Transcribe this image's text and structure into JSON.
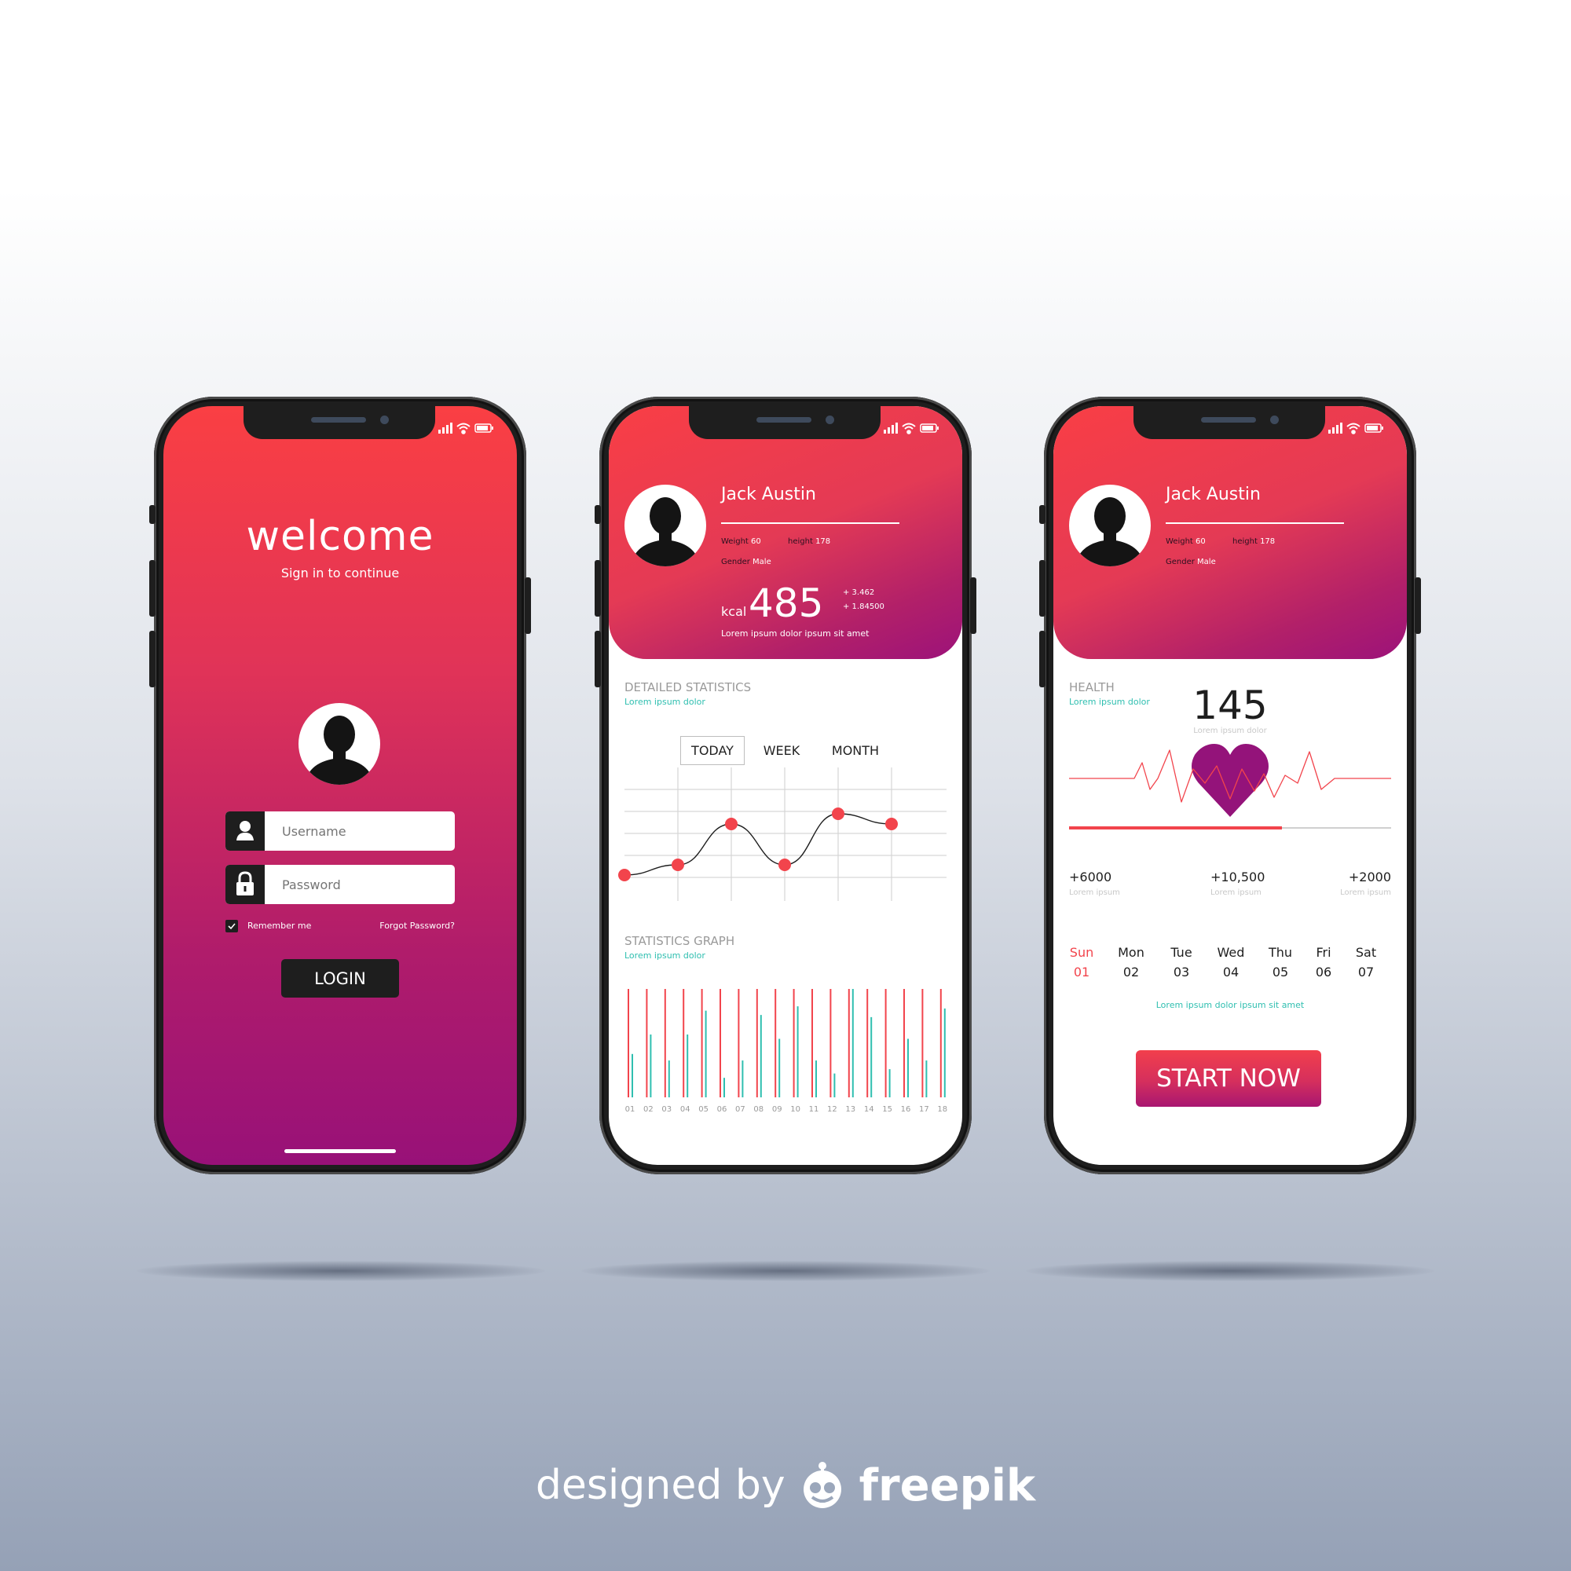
{
  "login_screen": {
    "title": "welcome",
    "subtitle": "Sign in to continue",
    "username_placeholder": "Username",
    "password_placeholder": "Password",
    "remember_label": "Remember me",
    "remember_checked": true,
    "forgot_label": "Forgot Password?",
    "login_label": "LOGIN"
  },
  "stats_screen": {
    "profile": {
      "name": "Jack Austin",
      "weight_label": "Weight",
      "weight_value": "60",
      "height_label": "height",
      "height_value": "178",
      "gender_label": "Gender",
      "gender_value": "Male"
    },
    "kcal_label": "kcal",
    "kcal_value": "485",
    "delta1": "+ 3.462",
    "delta2": "+ 1.84500",
    "caption": "Lorem ipsum dolor ipsum sit amet",
    "detailed_title": "DETAILED STATISTICS",
    "detailed_sub": "Lorem ipsum dolor",
    "tabs": [
      {
        "label": "TODAY",
        "active": true
      },
      {
        "label": "WEEK",
        "active": false
      },
      {
        "label": "MONTH",
        "active": false
      }
    ],
    "graph_title": "STATISTICS GRAPH",
    "graph_sub": "Lorem ipsum dolor"
  },
  "health_screen": {
    "profile": {
      "name": "Jack Austin",
      "weight_label": "Weight",
      "weight_value": "60",
      "height_label": "height",
      "height_value": "178",
      "gender_label": "Gender",
      "gender_value": "Male"
    },
    "health_title": "HEALTH",
    "health_sub": "Lorem ipsum dolor",
    "heart_rate": "145",
    "heart_rate_caption": "Lorem ipsum dolor",
    "progress": 0.66,
    "metrics": [
      {
        "value": "+6000",
        "caption": "Lorem ipsum"
      },
      {
        "value": "+10,500",
        "caption": "Lorem ipsum"
      },
      {
        "value": "+2000",
        "caption": "Lorem ipsum"
      }
    ],
    "days": [
      {
        "name": "Sun",
        "num": "01",
        "active": true
      },
      {
        "name": "Mon",
        "num": "02",
        "active": false
      },
      {
        "name": "Tue",
        "num": "03",
        "active": false
      },
      {
        "name": "Wed",
        "num": "04",
        "active": false
      },
      {
        "name": "Thu",
        "num": "05",
        "active": false
      },
      {
        "name": "Fri",
        "num": "06",
        "active": false
      },
      {
        "name": "Sat",
        "num": "07",
        "active": false
      }
    ],
    "days_caption": "Lorem ipsum dolor ipsum sit amet",
    "start_label": "START NOW"
  },
  "chart_data": [
    {
      "type": "line",
      "title": "",
      "x": [
        0,
        1,
        2,
        3,
        4,
        5
      ],
      "y": [
        0.5,
        1,
        3,
        1,
        3.5,
        3
      ],
      "ylim": [
        0,
        5
      ],
      "grid": true,
      "marker_color": "#f2444c"
    },
    {
      "type": "bar",
      "title": "STATISTICS GRAPH",
      "categories": [
        "01",
        "02",
        "03",
        "04",
        "05",
        "06",
        "07",
        "08",
        "09",
        "10",
        "11",
        "12",
        "13",
        "14",
        "15",
        "16",
        "17",
        "18"
      ],
      "series": [
        {
          "values": [
            100,
            100,
            100,
            100,
            100,
            100,
            100,
            100,
            100,
            100,
            100,
            100,
            100,
            100,
            100,
            100,
            100,
            100
          ],
          "color": "#f2444c"
        },
        {
          "values": [
            40,
            58,
            34,
            58,
            80,
            18,
            34,
            76,
            54,
            84,
            34,
            22,
            100,
            74,
            26,
            54,
            34,
            82
          ],
          "color": "#2fbfb0"
        }
      ],
      "ylim": [
        0,
        100
      ]
    }
  ],
  "watermark": {
    "designed_by": "designed by",
    "brand": "freepik"
  },
  "colors": {
    "gradient_top": "#f93e45",
    "gradient_bottom": "#9c127a",
    "accent_red": "#f2444c",
    "accent_teal": "#2fbfb0",
    "heart_purple": "#94137a",
    "dark": "#1e1e1e"
  },
  "icons": [
    "signal-icon",
    "wifi-icon",
    "battery-icon",
    "user-icon",
    "lock-icon",
    "check-icon",
    "heart-icon",
    "freepik-logo-icon"
  ]
}
